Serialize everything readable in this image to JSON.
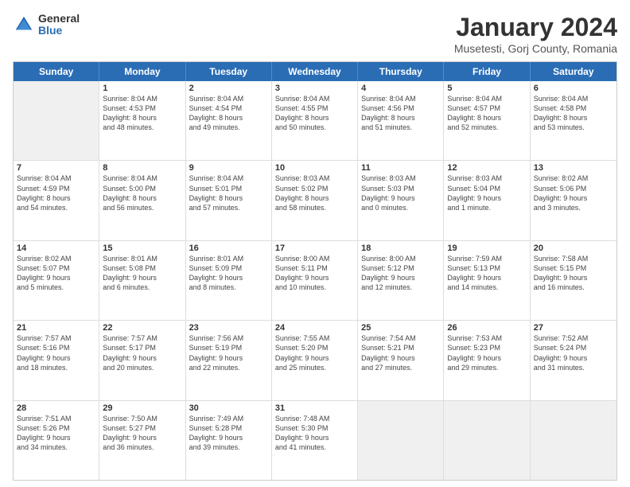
{
  "logo": {
    "general": "General",
    "blue": "Blue"
  },
  "title": "January 2024",
  "subtitle": "Musetesti, Gorj County, Romania",
  "header_days": [
    "Sunday",
    "Monday",
    "Tuesday",
    "Wednesday",
    "Thursday",
    "Friday",
    "Saturday"
  ],
  "weeks": [
    [
      {
        "day": null,
        "shaded": true
      },
      {
        "day": "1",
        "l1": "Sunrise: 8:04 AM",
        "l2": "Sunset: 4:53 PM",
        "l3": "Daylight: 8 hours",
        "l4": "and 48 minutes."
      },
      {
        "day": "2",
        "l1": "Sunrise: 8:04 AM",
        "l2": "Sunset: 4:54 PM",
        "l3": "Daylight: 8 hours",
        "l4": "and 49 minutes."
      },
      {
        "day": "3",
        "l1": "Sunrise: 8:04 AM",
        "l2": "Sunset: 4:55 PM",
        "l3": "Daylight: 8 hours",
        "l4": "and 50 minutes."
      },
      {
        "day": "4",
        "l1": "Sunrise: 8:04 AM",
        "l2": "Sunset: 4:56 PM",
        "l3": "Daylight: 8 hours",
        "l4": "and 51 minutes."
      },
      {
        "day": "5",
        "l1": "Sunrise: 8:04 AM",
        "l2": "Sunset: 4:57 PM",
        "l3": "Daylight: 8 hours",
        "l4": "and 52 minutes."
      },
      {
        "day": "6",
        "l1": "Sunrise: 8:04 AM",
        "l2": "Sunset: 4:58 PM",
        "l3": "Daylight: 8 hours",
        "l4": "and 53 minutes."
      }
    ],
    [
      {
        "day": "7",
        "l1": "Sunrise: 8:04 AM",
        "l2": "Sunset: 4:59 PM",
        "l3": "Daylight: 8 hours",
        "l4": "and 54 minutes."
      },
      {
        "day": "8",
        "l1": "Sunrise: 8:04 AM",
        "l2": "Sunset: 5:00 PM",
        "l3": "Daylight: 8 hours",
        "l4": "and 56 minutes."
      },
      {
        "day": "9",
        "l1": "Sunrise: 8:04 AM",
        "l2": "Sunset: 5:01 PM",
        "l3": "Daylight: 8 hours",
        "l4": "and 57 minutes."
      },
      {
        "day": "10",
        "l1": "Sunrise: 8:03 AM",
        "l2": "Sunset: 5:02 PM",
        "l3": "Daylight: 8 hours",
        "l4": "and 58 minutes."
      },
      {
        "day": "11",
        "l1": "Sunrise: 8:03 AM",
        "l2": "Sunset: 5:03 PM",
        "l3": "Daylight: 9 hours",
        "l4": "and 0 minutes."
      },
      {
        "day": "12",
        "l1": "Sunrise: 8:03 AM",
        "l2": "Sunset: 5:04 PM",
        "l3": "Daylight: 9 hours",
        "l4": "and 1 minute."
      },
      {
        "day": "13",
        "l1": "Sunrise: 8:02 AM",
        "l2": "Sunset: 5:06 PM",
        "l3": "Daylight: 9 hours",
        "l4": "and 3 minutes."
      }
    ],
    [
      {
        "day": "14",
        "l1": "Sunrise: 8:02 AM",
        "l2": "Sunset: 5:07 PM",
        "l3": "Daylight: 9 hours",
        "l4": "and 5 minutes."
      },
      {
        "day": "15",
        "l1": "Sunrise: 8:01 AM",
        "l2": "Sunset: 5:08 PM",
        "l3": "Daylight: 9 hours",
        "l4": "and 6 minutes."
      },
      {
        "day": "16",
        "l1": "Sunrise: 8:01 AM",
        "l2": "Sunset: 5:09 PM",
        "l3": "Daylight: 9 hours",
        "l4": "and 8 minutes."
      },
      {
        "day": "17",
        "l1": "Sunrise: 8:00 AM",
        "l2": "Sunset: 5:11 PM",
        "l3": "Daylight: 9 hours",
        "l4": "and 10 minutes."
      },
      {
        "day": "18",
        "l1": "Sunrise: 8:00 AM",
        "l2": "Sunset: 5:12 PM",
        "l3": "Daylight: 9 hours",
        "l4": "and 12 minutes."
      },
      {
        "day": "19",
        "l1": "Sunrise: 7:59 AM",
        "l2": "Sunset: 5:13 PM",
        "l3": "Daylight: 9 hours",
        "l4": "and 14 minutes."
      },
      {
        "day": "20",
        "l1": "Sunrise: 7:58 AM",
        "l2": "Sunset: 5:15 PM",
        "l3": "Daylight: 9 hours",
        "l4": "and 16 minutes."
      }
    ],
    [
      {
        "day": "21",
        "l1": "Sunrise: 7:57 AM",
        "l2": "Sunset: 5:16 PM",
        "l3": "Daylight: 9 hours",
        "l4": "and 18 minutes."
      },
      {
        "day": "22",
        "l1": "Sunrise: 7:57 AM",
        "l2": "Sunset: 5:17 PM",
        "l3": "Daylight: 9 hours",
        "l4": "and 20 minutes."
      },
      {
        "day": "23",
        "l1": "Sunrise: 7:56 AM",
        "l2": "Sunset: 5:19 PM",
        "l3": "Daylight: 9 hours",
        "l4": "and 22 minutes."
      },
      {
        "day": "24",
        "l1": "Sunrise: 7:55 AM",
        "l2": "Sunset: 5:20 PM",
        "l3": "Daylight: 9 hours",
        "l4": "and 25 minutes."
      },
      {
        "day": "25",
        "l1": "Sunrise: 7:54 AM",
        "l2": "Sunset: 5:21 PM",
        "l3": "Daylight: 9 hours",
        "l4": "and 27 minutes."
      },
      {
        "day": "26",
        "l1": "Sunrise: 7:53 AM",
        "l2": "Sunset: 5:23 PM",
        "l3": "Daylight: 9 hours",
        "l4": "and 29 minutes."
      },
      {
        "day": "27",
        "l1": "Sunrise: 7:52 AM",
        "l2": "Sunset: 5:24 PM",
        "l3": "Daylight: 9 hours",
        "l4": "and 31 minutes."
      }
    ],
    [
      {
        "day": "28",
        "l1": "Sunrise: 7:51 AM",
        "l2": "Sunset: 5:26 PM",
        "l3": "Daylight: 9 hours",
        "l4": "and 34 minutes."
      },
      {
        "day": "29",
        "l1": "Sunrise: 7:50 AM",
        "l2": "Sunset: 5:27 PM",
        "l3": "Daylight: 9 hours",
        "l4": "and 36 minutes."
      },
      {
        "day": "30",
        "l1": "Sunrise: 7:49 AM",
        "l2": "Sunset: 5:28 PM",
        "l3": "Daylight: 9 hours",
        "l4": "and 39 minutes."
      },
      {
        "day": "31",
        "l1": "Sunrise: 7:48 AM",
        "l2": "Sunset: 5:30 PM",
        "l3": "Daylight: 9 hours",
        "l4": "and 41 minutes."
      },
      {
        "day": null,
        "shaded": true
      },
      {
        "day": null,
        "shaded": true
      },
      {
        "day": null,
        "shaded": true
      }
    ]
  ]
}
